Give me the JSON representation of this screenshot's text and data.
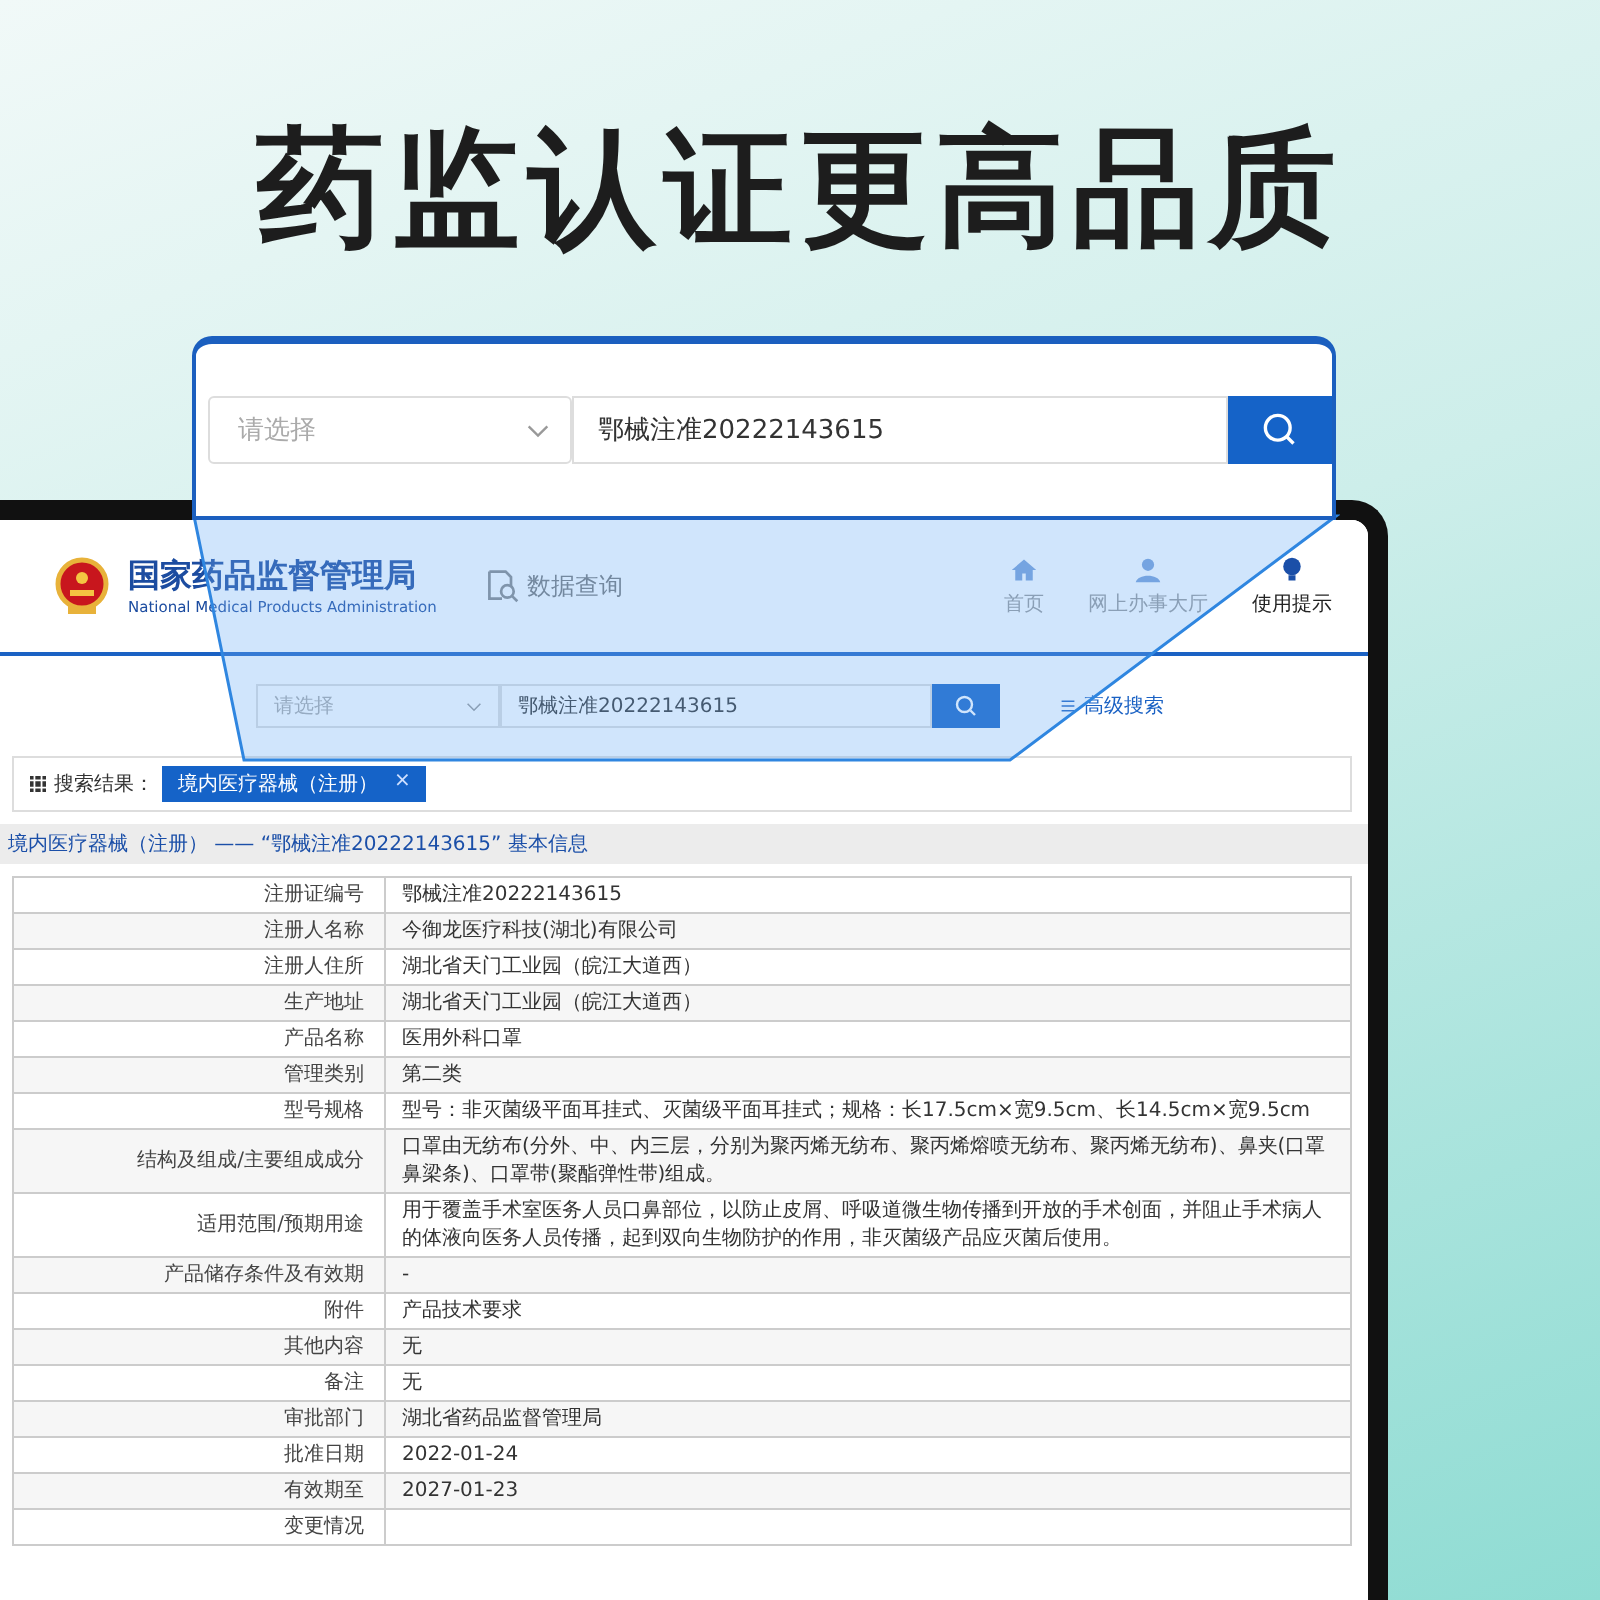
{
  "headline": "药监认证更高品质",
  "magnifier": {
    "select_placeholder": "请选择",
    "search_value": "鄂械注准20222143615"
  },
  "header": {
    "logo_title": "国家药品监督管理局",
    "logo_subtitle": "National Medical Products Administration",
    "section": "数据查询",
    "nav": [
      {
        "label": "首页",
        "kind": "home",
        "selected": false
      },
      {
        "label": "网上办事大厅",
        "kind": "person",
        "selected": false
      },
      {
        "label": "使用提示",
        "kind": "bulb",
        "selected": true
      }
    ]
  },
  "search": {
    "select_placeholder": "请选择",
    "value": "鄂械注准20222143615",
    "advanced_link": "高级搜索"
  },
  "results": {
    "label": "搜索结果：",
    "tags": [
      {
        "label": "境内医疗器械（注册）",
        "remove": "×"
      }
    ]
  },
  "section_title": "境内医疗器械（注册） —— “鄂械注准20222143615” 基本信息",
  "table": {
    "rows": [
      {
        "label": "注册证编号",
        "value": "鄂械注准20222143615"
      },
      {
        "label": "注册人名称",
        "value": "今御龙医疗科技(湖北)有限公司"
      },
      {
        "label": "注册人住所",
        "value": "湖北省天门工业园（皖江大道西）"
      },
      {
        "label": "生产地址",
        "value": "湖北省天门工业园（皖江大道西）"
      },
      {
        "label": "产品名称",
        "value": "医用外科口罩"
      },
      {
        "label": "管理类别",
        "value": "第二类"
      },
      {
        "label": "型号规格",
        "value": "型号：非灭菌级平面耳挂式、灭菌级平面耳挂式；规格：长17.5cm×宽9.5cm、长14.5cm×宽9.5cm"
      },
      {
        "label": "结构及组成/主要组成成分",
        "value": "口罩由无纺布(分外、中、内三层，分别为聚丙烯无纺布、聚丙烯熔喷无纺布、聚丙烯无纺布)、鼻夹(口罩鼻梁条)、口罩带(聚酯弹性带)组成。"
      },
      {
        "label": "适用范围/预期用途",
        "value": "用于覆盖手术室医务人员口鼻部位，以防止皮屑、呼吸道微生物传播到开放的手术创面，并阻止手术病人的体液向医务人员传播，起到双向生物防护的作用，非灭菌级产品应灭菌后使用。"
      },
      {
        "label": "产品储存条件及有效期",
        "value": "-"
      },
      {
        "label": "附件",
        "value": "产品技术要求"
      },
      {
        "label": "其他内容",
        "value": "无"
      },
      {
        "label": "备注",
        "value": "无"
      },
      {
        "label": "审批部门",
        "value": "湖北省药品监督管理局"
      },
      {
        "label": "批准日期",
        "value": "2022-01-24"
      },
      {
        "label": "有效期至",
        "value": "2027-01-23"
      },
      {
        "label": "变更情况",
        "value": ""
      }
    ]
  }
}
